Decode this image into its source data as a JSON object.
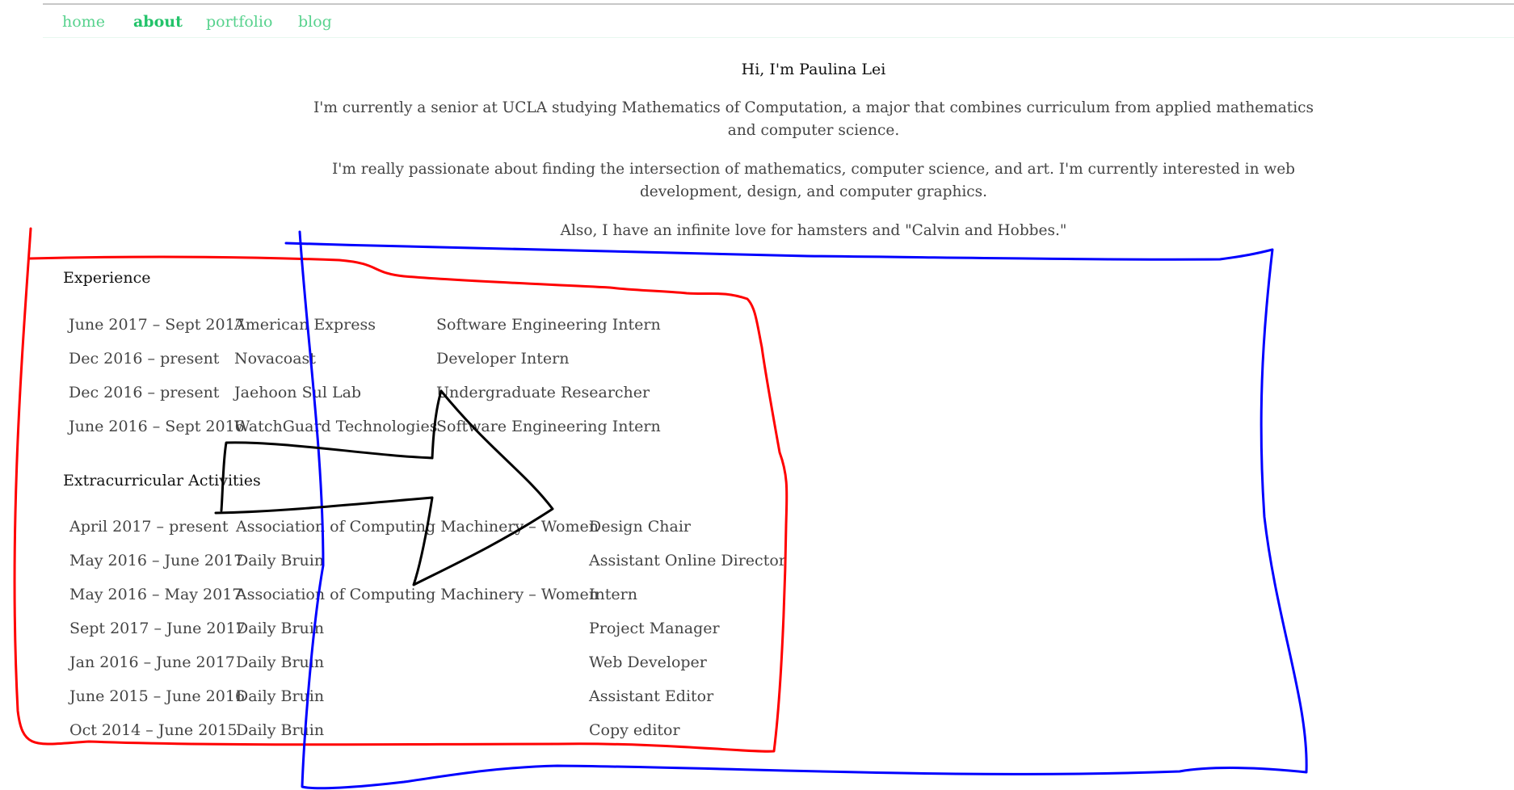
{
  "nav": {
    "items": [
      {
        "label": "home",
        "active": false
      },
      {
        "label": "about",
        "active": true
      },
      {
        "label": "portfolio",
        "active": false
      },
      {
        "label": "blog",
        "active": false
      }
    ],
    "colors": {
      "link": "#57d28d",
      "active": "#23c36a"
    }
  },
  "intro": {
    "title": "Hi, I'm Paulina Lei",
    "paragraphs": [
      "I'm currently a senior at UCLA studying Mathematics of Computation, a major that combines curriculum from applied mathematics and computer science.",
      "I'm really passionate about finding the intersection of mathematics, computer science, and art. I'm currently interested in web development, design, and computer graphics.",
      "Also, I have an infinite love for hamsters and \"Calvin and Hobbes.\""
    ]
  },
  "experience": {
    "heading": "Experience",
    "rows": [
      [
        "June 2017 – Sept 2017",
        "American Express",
        "Software Engineering Intern"
      ],
      [
        "Dec 2016 – present",
        "Novacoast",
        "Developer Intern"
      ],
      [
        "Dec 2016 – present",
        "Jaehoon Sul Lab",
        "Undergraduate Researcher"
      ],
      [
        "June 2016 – Sept 2016",
        "WatchGuard Technologies",
        "Software Engineering Intern"
      ]
    ]
  },
  "extracurricular": {
    "heading": "Extracurricular Activities",
    "rows": [
      [
        "April 2017 – present",
        "Association of Computing Machinery – Women",
        "Design Chair"
      ],
      [
        "May 2016 – June 2017",
        "Daily Bruin",
        "Assistant Online Director"
      ],
      [
        "May 2016 – May 2017",
        "Association of Computing Machinery – Women",
        "Intern"
      ],
      [
        "Sept 2017 – June 2017",
        "Daily Bruin",
        "Project Manager"
      ],
      [
        "Jan 2016 – June 2017",
        "Daily Bruin",
        "Web Developer"
      ],
      [
        "June 2015 – June 2016",
        "Daily Bruin",
        "Assistant Editor"
      ],
      [
        "Oct 2014 – June 2015",
        "Daily Bruin",
        "Copy editor"
      ]
    ]
  },
  "annotations": {
    "red_box_color": "#ff0000",
    "blue_box_color": "#0000ff",
    "arrow_color": "#000000"
  }
}
